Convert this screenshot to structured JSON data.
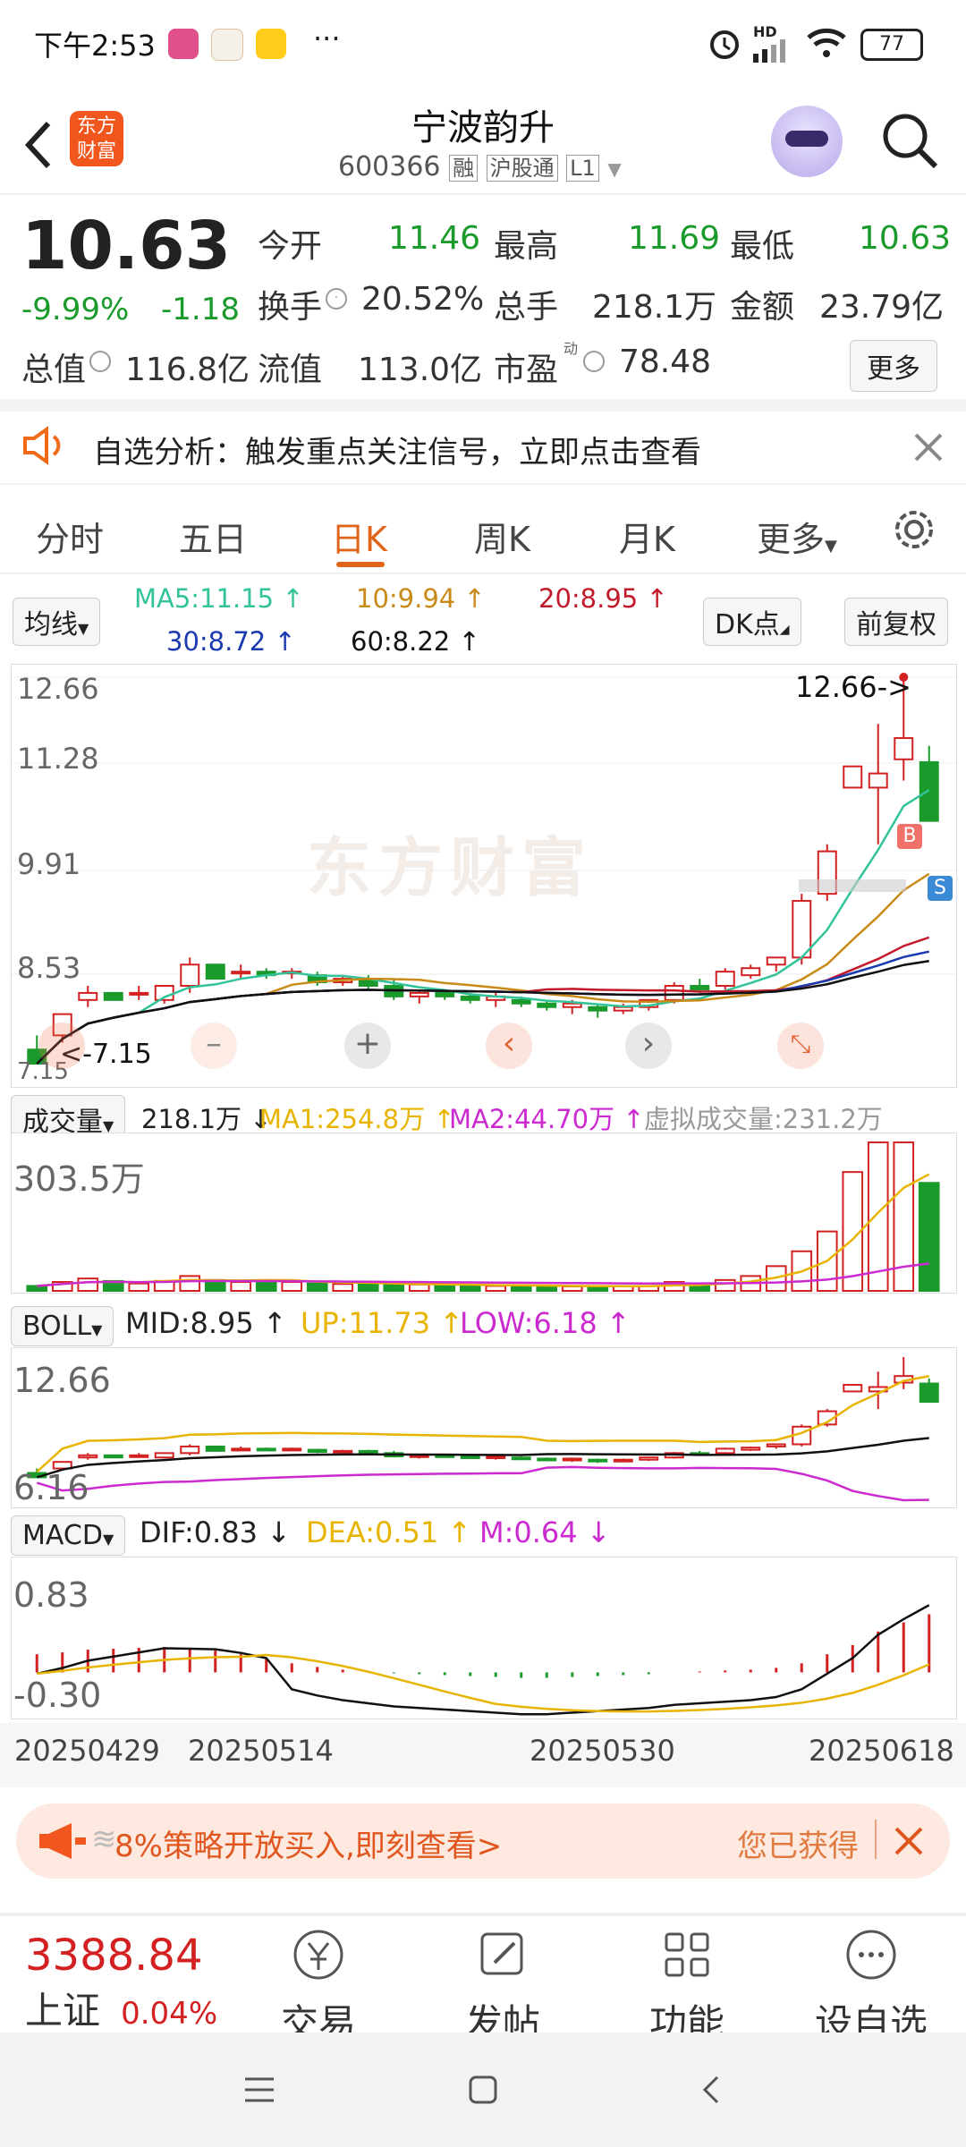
{
  "status_bar": {
    "time": "下午2:53",
    "signal": "HD",
    "battery": "77"
  },
  "header": {
    "brand": "东方财富",
    "stock_name": "宁波韵升",
    "stock_code": "600366",
    "tag_margin": "融",
    "tag_connect": "沪股通",
    "tag_level": "L1"
  },
  "quote": {
    "price": "10.63",
    "change_pct": "-9.99%",
    "change": "-1.18",
    "open_label": "今开",
    "open": "11.46",
    "high_label": "最高",
    "high": "11.69",
    "low_label": "最低",
    "low": "10.63",
    "turnover_label": "换手",
    "turnover": "20.52%",
    "volume_label": "总手",
    "volume": "218.1万",
    "amount_label": "金额",
    "amount": "23.79亿",
    "mktcap_label": "总值",
    "mktcap": "116.8亿",
    "float_label": "流值",
    "float": "113.0亿",
    "pe_label": "市盈",
    "pe_sup": "动",
    "pe": "78.48",
    "more_label": "更多"
  },
  "notice": {
    "text": "自选分析：触发重点关注信号，立即点击查看"
  },
  "tabs": [
    "分时",
    "五日",
    "日K",
    "周K",
    "月K",
    "更多"
  ],
  "active_tab": "日K",
  "ma": {
    "selector": "均线",
    "ma5": "MA5:11.15",
    "ma10": "10:9.94",
    "ma20": "20:8.95",
    "ma30": "30:8.72",
    "ma60": "60:8.22",
    "dk_label": "DK点",
    "fq_label": "前复权",
    "up": "↑"
  },
  "kline": {
    "y_top": "12.66",
    "y_2": "11.28",
    "y_3": "9.91",
    "y_4": "8.53",
    "max_marker": "12.66->",
    "min_marker": "7.15",
    "min_left": "7.15",
    "buy": "B",
    "sell": "S",
    "watermark": "东方财富"
  },
  "volume": {
    "selector": "成交量",
    "value": "218.1万",
    "down": "↓",
    "ma1": "MA1:254.8万",
    "ma2": "MA2:44.70万",
    "virtual": "虚拟成交量:231.2万",
    "y_top": "303.5万",
    "up": "↑"
  },
  "boll": {
    "selector": "BOLL",
    "mid": "MID:8.95",
    "up": "UP:11.73",
    "low": "LOW:6.18",
    "y_top": "12.66",
    "y_bottom": "6.16",
    "arrow": "↑"
  },
  "macd": {
    "selector": "MACD",
    "dif": "DIF:0.83",
    "dea": "DEA:0.51",
    "m": "M:0.64",
    "y_top": "0.83",
    "y_bottom": "-0.30",
    "down": "↓",
    "up": "↑"
  },
  "dates": [
    "20250429",
    "20250514",
    "20250530",
    "20250618"
  ],
  "ad": {
    "text": "8%策略开放买入,即刻查看>",
    "right": "您已获得",
    "prefix": "≋"
  },
  "index": {
    "value": "3388.84",
    "name": "上证",
    "pct": "0.04%"
  },
  "bottom_nav": [
    {
      "label": "交易",
      "icon": "yen-icon"
    },
    {
      "label": "发帖",
      "icon": "edit-icon"
    },
    {
      "label": "功能",
      "icon": "grid-icon"
    },
    {
      "label": "设自选",
      "icon": "more-icon"
    }
  ],
  "colors": {
    "up": "#d32020",
    "down": "#1a9a2a",
    "accent": "#f06a18",
    "ma5": "#33c39a",
    "ma10": "#c98a18",
    "ma20": "#c21a2a",
    "ma30": "#1a3ab0",
    "ma60": "#111111",
    "boll_up": "#e8b400",
    "boll_low": "#cc2ad0"
  },
  "chart_data": [
    {
      "type": "candlestick",
      "title": "日K",
      "ylim": [
        7.15,
        12.66
      ],
      "x_ticks": [
        "20250429",
        "20250514",
        "20250530",
        "20250618"
      ],
      "series": [
        {
          "name": "MA5",
          "last": 11.15
        },
        {
          "name": "MA10",
          "last": 9.94
        },
        {
          "name": "MA20",
          "last": 8.95
        },
        {
          "name": "MA30",
          "last": 8.72
        },
        {
          "name": "MA60",
          "last": 8.22
        }
      ],
      "candles": [
        [
          7.4,
          7.6,
          7.3,
          7.2
        ],
        [
          7.6,
          7.9,
          7.5,
          7.9
        ],
        [
          8.1,
          8.3,
          8.0,
          8.2
        ],
        [
          8.2,
          8.2,
          8.1,
          8.1
        ],
        [
          8.2,
          8.3,
          8.1,
          8.2
        ],
        [
          8.1,
          8.3,
          8.05,
          8.3
        ],
        [
          8.3,
          8.7,
          8.2,
          8.6
        ],
        [
          8.6,
          8.6,
          8.4,
          8.4
        ],
        [
          8.5,
          8.6,
          8.4,
          8.5
        ],
        [
          8.5,
          8.55,
          8.4,
          8.45
        ],
        [
          8.5,
          8.55,
          8.4,
          8.5
        ],
        [
          8.45,
          8.5,
          8.3,
          8.35
        ],
        [
          8.35,
          8.45,
          8.3,
          8.4
        ],
        [
          8.4,
          8.45,
          8.25,
          8.3
        ],
        [
          8.3,
          8.4,
          8.1,
          8.15
        ],
        [
          8.15,
          8.25,
          8.05,
          8.2
        ],
        [
          8.2,
          8.25,
          8.1,
          8.15
        ],
        [
          8.15,
          8.2,
          8.05,
          8.1
        ],
        [
          8.1,
          8.2,
          8.0,
          8.15
        ],
        [
          8.1,
          8.15,
          8.0,
          8.05
        ],
        [
          8.05,
          8.1,
          7.95,
          8.0
        ],
        [
          8.0,
          8.1,
          7.9,
          8.05
        ],
        [
          8.0,
          8.05,
          7.85,
          7.95
        ],
        [
          7.95,
          8.05,
          7.9,
          8.0
        ],
        [
          8.0,
          8.1,
          7.95,
          8.1
        ],
        [
          8.1,
          8.35,
          8.05,
          8.3
        ],
        [
          8.3,
          8.4,
          8.2,
          8.25
        ],
        [
          8.3,
          8.55,
          8.25,
          8.5
        ],
        [
          8.45,
          8.6,
          8.4,
          8.55
        ],
        [
          8.6,
          8.7,
          8.5,
          8.7
        ],
        [
          8.7,
          9.6,
          8.6,
          9.5
        ],
        [
          9.6,
          10.3,
          9.5,
          10.2
        ],
        [
          11.1,
          11.4,
          11.1,
          11.4
        ],
        [
          11.1,
          12.0,
          10.3,
          11.3
        ],
        [
          11.5,
          12.66,
          11.2,
          11.8
        ],
        [
          11.46,
          11.69,
          10.63,
          10.63
        ]
      ]
    },
    {
      "type": "bar",
      "title": "成交量",
      "ylim": [
        0,
        303.5
      ],
      "series": [
        {
          "name": "成交量",
          "last": 218.1
        },
        {
          "name": "MA1",
          "last": 254.8
        },
        {
          "name": "MA2",
          "last": 44.7
        }
      ],
      "values": [
        10,
        18,
        25,
        20,
        15,
        20,
        30,
        22,
        18,
        20,
        18,
        15,
        14,
        15,
        12,
        13,
        12,
        11,
        10,
        10,
        10,
        9,
        9,
        9,
        10,
        18,
        14,
        22,
        30,
        50,
        80,
        120,
        240,
        300,
        300,
        218.1
      ]
    },
    {
      "type": "line",
      "title": "BOLL",
      "ylim": [
        6.16,
        12.66
      ],
      "series": [
        {
          "name": "MID",
          "last": 8.95
        },
        {
          "name": "UP",
          "last": 11.73
        },
        {
          "name": "LOW",
          "last": 6.18
        }
      ]
    },
    {
      "type": "bar",
      "title": "MACD",
      "ylim": [
        -0.3,
        0.83
      ],
      "series": [
        {
          "name": "DIF",
          "last": 0.83
        },
        {
          "name": "DEA",
          "last": 0.51
        },
        {
          "name": "M",
          "last": 0.64
        }
      ],
      "values": [
        0.2,
        0.22,
        0.25,
        0.26,
        0.27,
        0.28,
        0.26,
        0.24,
        0.2,
        0.15,
        0.1,
        0.06,
        0.03,
        0.01,
        -0.01,
        -0.02,
        -0.03,
        -0.04,
        -0.05,
        -0.06,
        -0.06,
        -0.05,
        -0.04,
        -0.03,
        -0.02,
        0.0,
        0.01,
        0.02,
        0.03,
        0.05,
        0.1,
        0.2,
        0.3,
        0.45,
        0.55,
        0.64
      ]
    }
  ]
}
